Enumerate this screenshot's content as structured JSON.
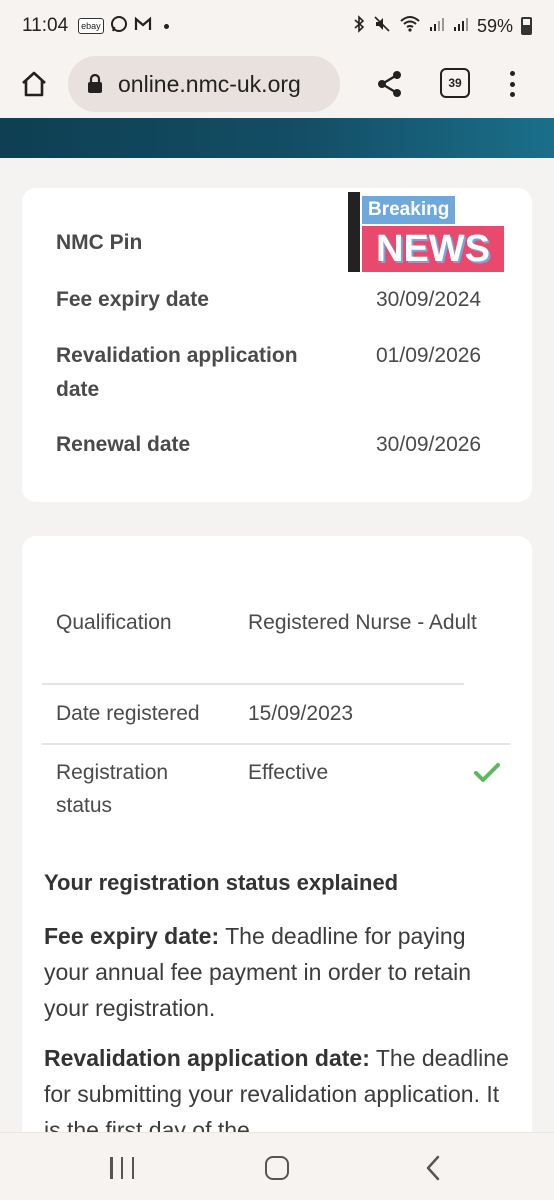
{
  "status_bar": {
    "time": "11:04",
    "ebay_label": "ebay",
    "battery": "59%"
  },
  "browser": {
    "url": "online.nmc-uk.org",
    "tab_count": "39"
  },
  "badge": {
    "line1": "Breaking",
    "line2": "NEWS"
  },
  "registration": {
    "rows": [
      {
        "label": "NMC Pin",
        "value": ""
      },
      {
        "label": "Fee expiry date",
        "value": "30/09/2024"
      },
      {
        "label": "Revalidation application date",
        "value": "01/09/2026"
      },
      {
        "label": "Renewal date",
        "value": "30/09/2026"
      }
    ]
  },
  "qualification": {
    "rows": [
      {
        "label": "Qualification",
        "value": "Registered Nurse - Adult"
      },
      {
        "label": "Date registered",
        "value": "15/09/2023"
      },
      {
        "label": "Registration status",
        "value": "Effective"
      }
    ]
  },
  "explained": {
    "title": "Your registration status explained",
    "fee_term": "Fee expiry date:",
    "fee_text": " The deadline for paying your annual fee payment in order to retain your registration.",
    "reval_term": "Revalidation application date:",
    "reval_text": " The deadline for submitting your revalidation application. It is the first day of the"
  },
  "colors": {
    "header_band": "#134e66",
    "check": "#5cb85c",
    "badge_pink": "#e8496c",
    "badge_blue": "#6fa8dc"
  }
}
